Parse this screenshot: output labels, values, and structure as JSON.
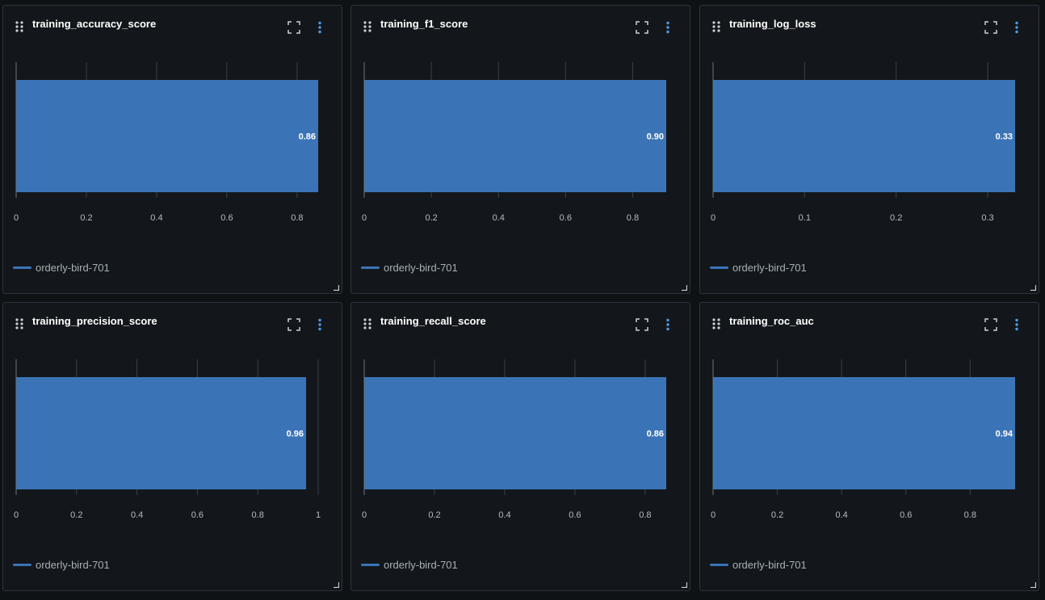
{
  "colors": {
    "bar": "#3b74b6",
    "grid": "#3a4047",
    "axis": "#6b737b",
    "panel_bg": "#13171b"
  },
  "panels": [
    {
      "title": "training_accuracy_score",
      "legend": "orderly-bird-701"
    },
    {
      "title": "training_f1_score",
      "legend": "orderly-bird-701"
    },
    {
      "title": "training_log_loss",
      "legend": "orderly-bird-701"
    },
    {
      "title": "training_precision_score",
      "legend": "orderly-bird-701"
    },
    {
      "title": "training_recall_score",
      "legend": "orderly-bird-701"
    },
    {
      "title": "training_roc_auc",
      "legend": "orderly-bird-701"
    }
  ],
  "chart_data": [
    {
      "type": "bar",
      "orientation": "horizontal",
      "title": "training_accuracy_score",
      "series": [
        {
          "name": "orderly-bird-701",
          "values": [
            0.86
          ]
        }
      ],
      "value_labels": [
        "0.86"
      ],
      "xlim": [
        0,
        0.86
      ],
      "xticks": [
        0,
        0.2,
        0.4,
        0.6,
        0.8
      ],
      "xtick_labels": [
        "0",
        "0.2",
        "0.4",
        "0.6",
        "0.8"
      ],
      "grid": true
    },
    {
      "type": "bar",
      "orientation": "horizontal",
      "title": "training_f1_score",
      "series": [
        {
          "name": "orderly-bird-701",
          "values": [
            0.9
          ]
        }
      ],
      "value_labels": [
        "0.90"
      ],
      "xlim": [
        0,
        0.9
      ],
      "xticks": [
        0,
        0.2,
        0.4,
        0.6,
        0.8
      ],
      "xtick_labels": [
        "0",
        "0.2",
        "0.4",
        "0.6",
        "0.8"
      ],
      "grid": true
    },
    {
      "type": "bar",
      "orientation": "horizontal",
      "title": "training_log_loss",
      "series": [
        {
          "name": "orderly-bird-701",
          "values": [
            0.33
          ]
        }
      ],
      "value_labels": [
        "0.33"
      ],
      "xlim": [
        0,
        0.33
      ],
      "xticks": [
        0,
        0.1,
        0.2,
        0.3
      ],
      "xtick_labels": [
        "0",
        "0.1",
        "0.2",
        "0.3"
      ],
      "grid": true
    },
    {
      "type": "bar",
      "orientation": "horizontal",
      "title": "training_precision_score",
      "series": [
        {
          "name": "orderly-bird-701",
          "values": [
            0.96
          ]
        }
      ],
      "value_labels": [
        "0.96"
      ],
      "xlim": [
        0,
        1
      ],
      "xticks": [
        0,
        0.2,
        0.4,
        0.6,
        0.8,
        1
      ],
      "xtick_labels": [
        "0",
        "0.2",
        "0.4",
        "0.6",
        "0.8",
        "1"
      ],
      "grid": true
    },
    {
      "type": "bar",
      "orientation": "horizontal",
      "title": "training_recall_score",
      "series": [
        {
          "name": "orderly-bird-701",
          "values": [
            0.86
          ]
        }
      ],
      "value_labels": [
        "0.86"
      ],
      "xlim": [
        0,
        0.86
      ],
      "xticks": [
        0,
        0.2,
        0.4,
        0.6,
        0.8
      ],
      "xtick_labels": [
        "0",
        "0.2",
        "0.4",
        "0.6",
        "0.8"
      ],
      "grid": true
    },
    {
      "type": "bar",
      "orientation": "horizontal",
      "title": "training_roc_auc",
      "series": [
        {
          "name": "orderly-bird-701",
          "values": [
            0.94
          ]
        }
      ],
      "value_labels": [
        "0.94"
      ],
      "xlim": [
        0,
        0.94
      ],
      "xticks": [
        0,
        0.2,
        0.4,
        0.6,
        0.8
      ],
      "xtick_labels": [
        "0",
        "0.2",
        "0.4",
        "0.6",
        "0.8"
      ],
      "grid": true
    }
  ]
}
